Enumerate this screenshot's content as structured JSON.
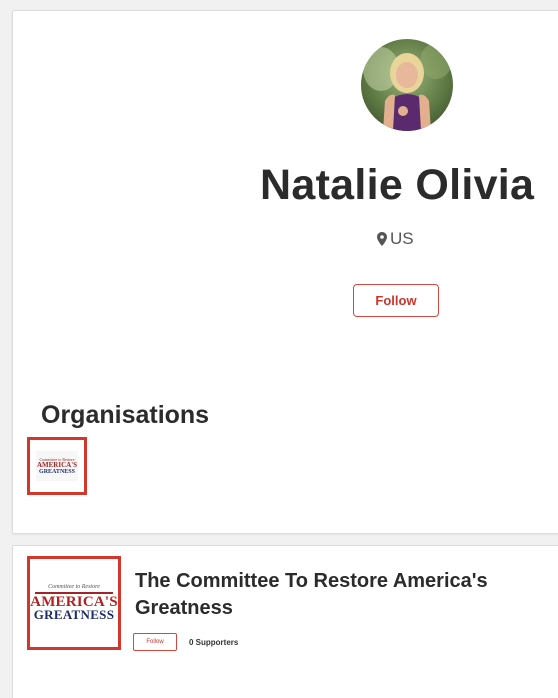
{
  "profile": {
    "avatar_icon": "user-photo",
    "name": "Natalie Olivia",
    "location_icon": "map-pin-icon",
    "location": "US",
    "follow_label": "Follow"
  },
  "organisations_section": {
    "title": "Organisations",
    "thumb_logo": {
      "line1": "Committee to Restore",
      "line2": "AMERICA'S",
      "line3": "GREATNESS"
    }
  },
  "organisation_card": {
    "logo": {
      "line1": "Committee to Restore",
      "line2": "AMERICA'S",
      "line3": "GREATNESS"
    },
    "name": "The Committee To Restore America's Greatness",
    "follow_label": "Follow",
    "supporters": "0 Supporters"
  },
  "colors": {
    "accent": "#d1372b",
    "text": "#2b2b2b",
    "background": "#f1f1f1",
    "card": "#ffffff"
  }
}
